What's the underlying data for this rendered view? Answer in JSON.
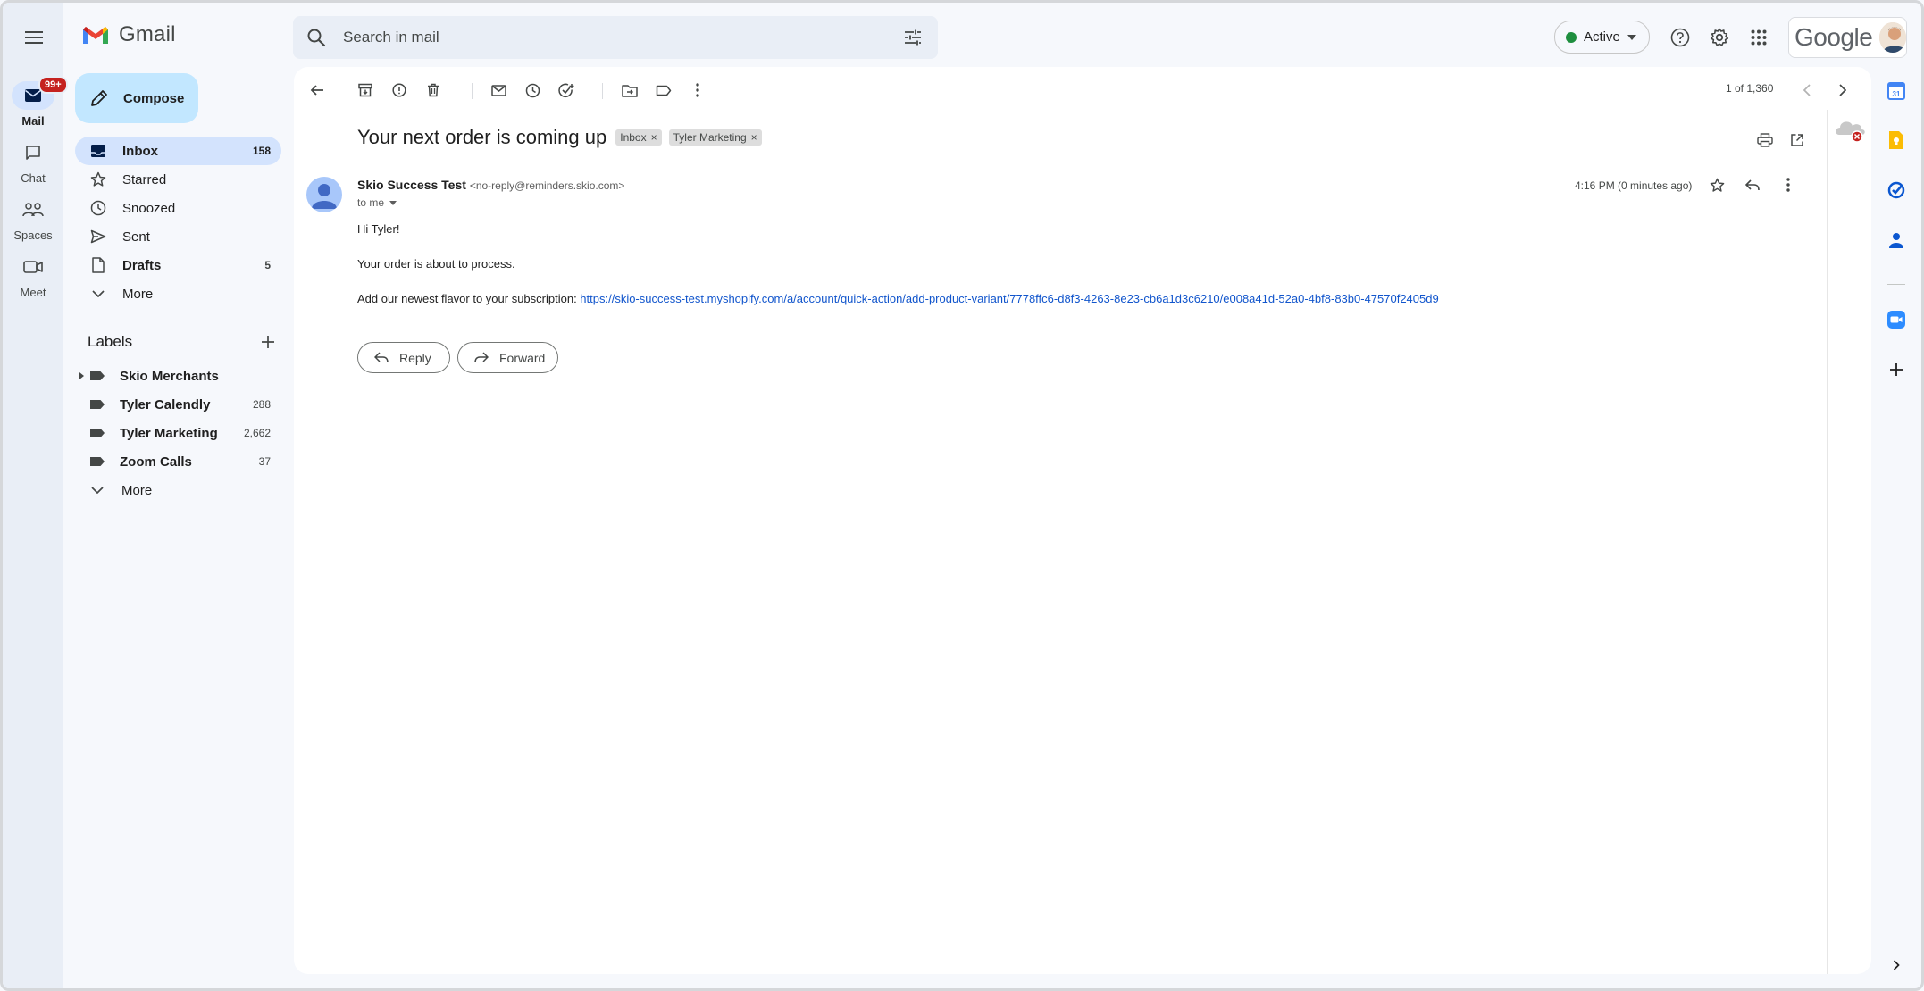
{
  "app": {
    "name": "Gmail"
  },
  "search": {
    "placeholder": "Search in mail"
  },
  "header": {
    "status_label": "Active",
    "google_wordmark": "Google"
  },
  "rail": {
    "mail_label": "Mail",
    "mail_badge": "99+",
    "chat_label": "Chat",
    "spaces_label": "Spaces",
    "meet_label": "Meet"
  },
  "compose": {
    "label": "Compose"
  },
  "nav": {
    "items": [
      {
        "label": "Inbox",
        "count": "158",
        "icon": "inbox-icon"
      },
      {
        "label": "Starred",
        "count": "",
        "icon": "star-icon"
      },
      {
        "label": "Snoozed",
        "count": "",
        "icon": "clock-icon"
      },
      {
        "label": "Sent",
        "count": "",
        "icon": "send-icon"
      },
      {
        "label": "Drafts",
        "count": "5",
        "icon": "draft-icon"
      },
      {
        "label": "More",
        "count": "",
        "icon": "chevron-down-icon"
      }
    ]
  },
  "labels": {
    "title": "Labels",
    "items": [
      {
        "label": "Skio Merchants",
        "count": ""
      },
      {
        "label": "Tyler Calendly",
        "count": "288"
      },
      {
        "label": "Tyler Marketing",
        "count": "2,662"
      },
      {
        "label": "Zoom Calls",
        "count": "37"
      }
    ],
    "more_label": "More"
  },
  "message": {
    "pager": "1 of 1,360",
    "subject": "Your next order is coming up",
    "chips": [
      "Inbox",
      "Tyler Marketing"
    ],
    "sender_name": "Skio Success Test",
    "sender_email": "<no-reply@reminders.skio.com>",
    "to": "to me",
    "timestamp": "4:16 PM (0 minutes ago)",
    "body": {
      "greeting": "Hi Tyler!",
      "line1": "Your order is about to process.",
      "line2_prefix": "Add our newest flavor to your subscription: ",
      "link": "https://skio-success-test.myshopify.com/a/account/quick-action/add-product-variant/7778ffc6-d8f3-4263-8e23-cb6a1d3c6210/e008a41d-52a0-4bf8-83b0-47570f2405d9"
    },
    "reply_label": "Reply",
    "forward_label": "Forward"
  },
  "colors": {
    "accent": "#0b57d0",
    "compose_bg": "#c2e7ff",
    "active_nav_bg": "#d3e3fd",
    "status_green": "#1e8e3e",
    "badge_red": "#c5221f",
    "link": "#1155cc"
  }
}
